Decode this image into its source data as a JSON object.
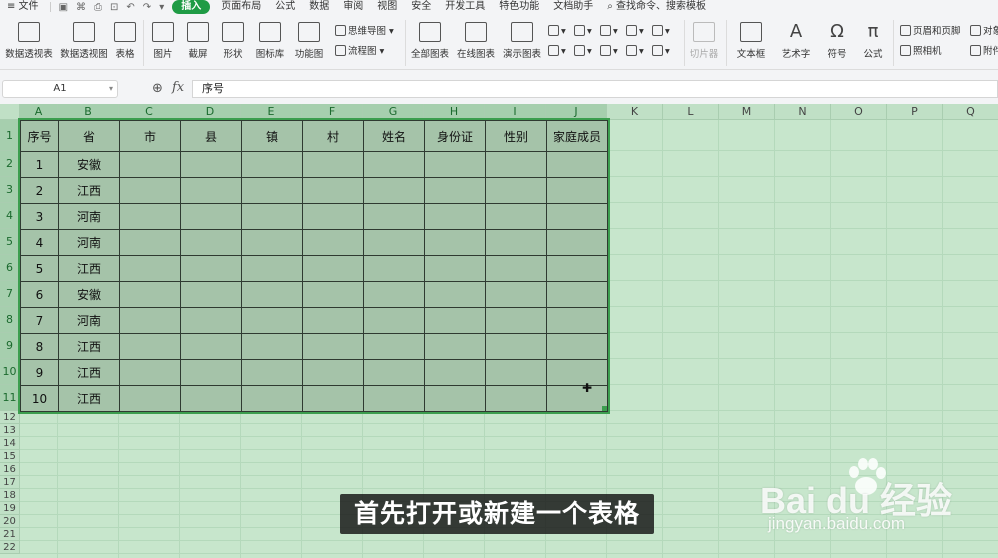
{
  "menubar": {
    "file": "≡ 文件",
    "tabs": [
      "插入",
      "页面布局",
      "公式",
      "数据",
      "审阅",
      "视图",
      "安全",
      "开发工具",
      "特色功能",
      "文档助手"
    ],
    "active_tab": "插入",
    "search": "查找命令、搜索模板"
  },
  "toolbar": {
    "pivot_table": "数据透视表",
    "pivot_chart": "数据透视图",
    "table": "表格",
    "picture": "图片",
    "screenshot": "截屏",
    "shape": "形状",
    "icon_lib": "图标库",
    "func_chart": "功能图",
    "mindmap": "思维导图",
    "flowchart": "流程图",
    "all_charts": "全部图表",
    "online_charts": "在线图表",
    "demo_charts": "演示图表",
    "slicer": "切片器",
    "textbox": "文本框",
    "wordart": "艺术字",
    "symbol": "符号",
    "formula": "公式",
    "header_footer": "页眉和页脚",
    "camera": "照相机",
    "object": "对象",
    "attachment": "附件"
  },
  "formula_bar": {
    "cell_ref": "A1",
    "fx": "fx",
    "content": "序号"
  },
  "columns": [
    "A",
    "B",
    "C",
    "D",
    "E",
    "F",
    "G",
    "H",
    "I",
    "J",
    "K",
    "L",
    "M",
    "N",
    "O",
    "P",
    "Q"
  ],
  "rows": [
    "1",
    "2",
    "3",
    "4",
    "5",
    "6",
    "7",
    "8",
    "9",
    "10",
    "11",
    "12",
    "13",
    "14",
    "15",
    "16",
    "17",
    "18",
    "19",
    "20",
    "21",
    "22"
  ],
  "table": {
    "headers": [
      "序号",
      "省",
      "市",
      "县",
      "镇",
      "村",
      "姓名",
      "身份证",
      "性别",
      "家庭成员"
    ],
    "rows": [
      [
        "1",
        "安徽"
      ],
      [
        "2",
        "江西"
      ],
      [
        "3",
        "河南"
      ],
      [
        "4",
        "河南"
      ],
      [
        "5",
        "江西"
      ],
      [
        "6",
        "安徽"
      ],
      [
        "7",
        "河南"
      ],
      [
        "8",
        "江西"
      ],
      [
        "9",
        "江西"
      ],
      [
        "10",
        "江西"
      ]
    ]
  },
  "subtitle": "首先打开或新建一个表格",
  "watermark": {
    "brand": "Bai du 经验",
    "url": "jingyan.baidu.com"
  },
  "colors": {
    "accent": "#1f9b45",
    "sheet_bg": "#c7e6cc",
    "table_fill": "#a5c3a9",
    "selection_border": "#3c9e4f"
  }
}
